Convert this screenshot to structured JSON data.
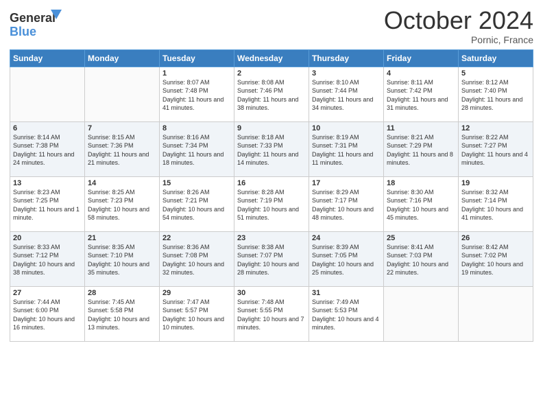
{
  "header": {
    "logo_line1a": "General",
    "logo_line1b": "Blue",
    "month": "October 2024",
    "location": "Pornic, France"
  },
  "weekdays": [
    "Sunday",
    "Monday",
    "Tuesday",
    "Wednesday",
    "Thursday",
    "Friday",
    "Saturday"
  ],
  "weeks": [
    [
      {
        "day": "",
        "info": ""
      },
      {
        "day": "",
        "info": ""
      },
      {
        "day": "1",
        "info": "Sunrise: 8:07 AM\nSunset: 7:48 PM\nDaylight: 11 hours and 41 minutes."
      },
      {
        "day": "2",
        "info": "Sunrise: 8:08 AM\nSunset: 7:46 PM\nDaylight: 11 hours and 38 minutes."
      },
      {
        "day": "3",
        "info": "Sunrise: 8:10 AM\nSunset: 7:44 PM\nDaylight: 11 hours and 34 minutes."
      },
      {
        "day": "4",
        "info": "Sunrise: 8:11 AM\nSunset: 7:42 PM\nDaylight: 11 hours and 31 minutes."
      },
      {
        "day": "5",
        "info": "Sunrise: 8:12 AM\nSunset: 7:40 PM\nDaylight: 11 hours and 28 minutes."
      }
    ],
    [
      {
        "day": "6",
        "info": "Sunrise: 8:14 AM\nSunset: 7:38 PM\nDaylight: 11 hours and 24 minutes."
      },
      {
        "day": "7",
        "info": "Sunrise: 8:15 AM\nSunset: 7:36 PM\nDaylight: 11 hours and 21 minutes."
      },
      {
        "day": "8",
        "info": "Sunrise: 8:16 AM\nSunset: 7:34 PM\nDaylight: 11 hours and 18 minutes."
      },
      {
        "day": "9",
        "info": "Sunrise: 8:18 AM\nSunset: 7:33 PM\nDaylight: 11 hours and 14 minutes."
      },
      {
        "day": "10",
        "info": "Sunrise: 8:19 AM\nSunset: 7:31 PM\nDaylight: 11 hours and 11 minutes."
      },
      {
        "day": "11",
        "info": "Sunrise: 8:21 AM\nSunset: 7:29 PM\nDaylight: 11 hours and 8 minutes."
      },
      {
        "day": "12",
        "info": "Sunrise: 8:22 AM\nSunset: 7:27 PM\nDaylight: 11 hours and 4 minutes."
      }
    ],
    [
      {
        "day": "13",
        "info": "Sunrise: 8:23 AM\nSunset: 7:25 PM\nDaylight: 11 hours and 1 minute."
      },
      {
        "day": "14",
        "info": "Sunrise: 8:25 AM\nSunset: 7:23 PM\nDaylight: 10 hours and 58 minutes."
      },
      {
        "day": "15",
        "info": "Sunrise: 8:26 AM\nSunset: 7:21 PM\nDaylight: 10 hours and 54 minutes."
      },
      {
        "day": "16",
        "info": "Sunrise: 8:28 AM\nSunset: 7:19 PM\nDaylight: 10 hours and 51 minutes."
      },
      {
        "day": "17",
        "info": "Sunrise: 8:29 AM\nSunset: 7:17 PM\nDaylight: 10 hours and 48 minutes."
      },
      {
        "day": "18",
        "info": "Sunrise: 8:30 AM\nSunset: 7:16 PM\nDaylight: 10 hours and 45 minutes."
      },
      {
        "day": "19",
        "info": "Sunrise: 8:32 AM\nSunset: 7:14 PM\nDaylight: 10 hours and 41 minutes."
      }
    ],
    [
      {
        "day": "20",
        "info": "Sunrise: 8:33 AM\nSunset: 7:12 PM\nDaylight: 10 hours and 38 minutes."
      },
      {
        "day": "21",
        "info": "Sunrise: 8:35 AM\nSunset: 7:10 PM\nDaylight: 10 hours and 35 minutes."
      },
      {
        "day": "22",
        "info": "Sunrise: 8:36 AM\nSunset: 7:08 PM\nDaylight: 10 hours and 32 minutes."
      },
      {
        "day": "23",
        "info": "Sunrise: 8:38 AM\nSunset: 7:07 PM\nDaylight: 10 hours and 28 minutes."
      },
      {
        "day": "24",
        "info": "Sunrise: 8:39 AM\nSunset: 7:05 PM\nDaylight: 10 hours and 25 minutes."
      },
      {
        "day": "25",
        "info": "Sunrise: 8:41 AM\nSunset: 7:03 PM\nDaylight: 10 hours and 22 minutes."
      },
      {
        "day": "26",
        "info": "Sunrise: 8:42 AM\nSunset: 7:02 PM\nDaylight: 10 hours and 19 minutes."
      }
    ],
    [
      {
        "day": "27",
        "info": "Sunrise: 7:44 AM\nSunset: 6:00 PM\nDaylight: 10 hours and 16 minutes."
      },
      {
        "day": "28",
        "info": "Sunrise: 7:45 AM\nSunset: 5:58 PM\nDaylight: 10 hours and 13 minutes."
      },
      {
        "day": "29",
        "info": "Sunrise: 7:47 AM\nSunset: 5:57 PM\nDaylight: 10 hours and 10 minutes."
      },
      {
        "day": "30",
        "info": "Sunrise: 7:48 AM\nSunset: 5:55 PM\nDaylight: 10 hours and 7 minutes."
      },
      {
        "day": "31",
        "info": "Sunrise: 7:49 AM\nSunset: 5:53 PM\nDaylight: 10 hours and 4 minutes."
      },
      {
        "day": "",
        "info": ""
      },
      {
        "day": "",
        "info": ""
      }
    ]
  ]
}
